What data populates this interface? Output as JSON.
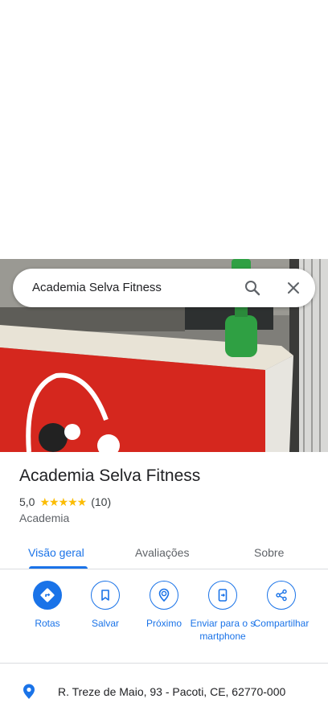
{
  "search": {
    "query": "Academia Selva Fitness"
  },
  "place": {
    "name": "Academia Selva Fitness",
    "rating": "5,0",
    "stars": "★★★★★",
    "review_count": "(10)",
    "category": "Academia"
  },
  "tabs": [
    {
      "label": "Visão geral"
    },
    {
      "label": "Avaliações"
    },
    {
      "label": "Sobre"
    }
  ],
  "actions": [
    {
      "label": "Rotas",
      "icon": "directions-icon"
    },
    {
      "label": "Salvar",
      "icon": "bookmark-icon"
    },
    {
      "label": "Próximo",
      "icon": "nearby-icon"
    },
    {
      "label": "Enviar para o smartphone",
      "icon": "send-to-phone-icon"
    },
    {
      "label": "Compartilhar",
      "icon": "share-icon"
    }
  ],
  "address": "R. Treze de Maio, 93 - Pacoti, CE, 62770-000",
  "colors": {
    "accent": "#1a73e8",
    "star": "#fbbc04",
    "text": "#202124",
    "secondary_text": "#5f6368"
  }
}
